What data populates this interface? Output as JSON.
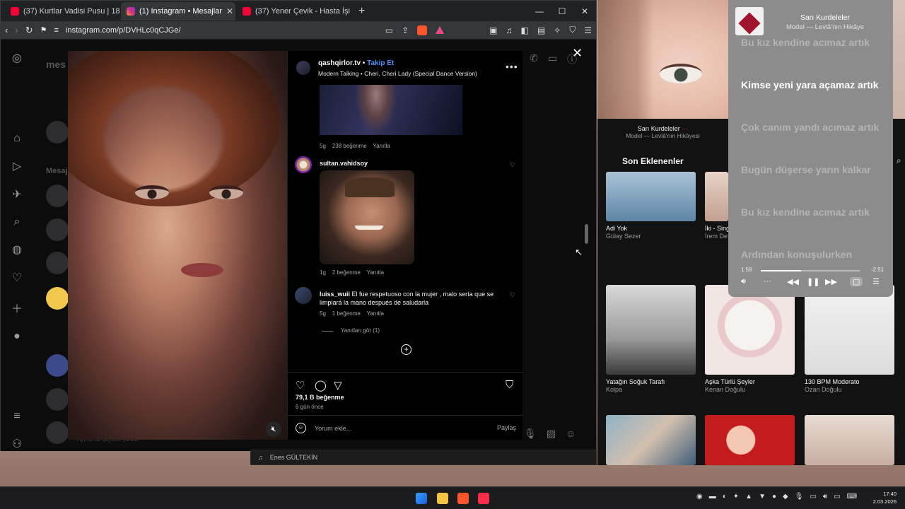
{
  "browser": {
    "tabs": [
      {
        "label": "(37) Kurtlar Vadisi Pusu | 189. Bölüm",
        "icon": "youtube-icon",
        "active": false
      },
      {
        "label": "(1) Instagram • Mesajlar",
        "icon": "instagram-icon",
        "active": true
      },
      {
        "label": "(37) Yener Çevik - Hasta İşi (Ben Büdü",
        "icon": "youtube-icon",
        "active": false
      }
    ],
    "url": "instagram.com/p/DVHLc0qCJGe/"
  },
  "instagram": {
    "dm_title": "mes",
    "messages_label": "Mesaj",
    "composer_text": "Ayırını bir şeylere yamar",
    "post": {
      "username": "qashqirlor.tv",
      "follow_label": "Takip Et",
      "audio": "Modern Talking • Cheri, Cheri Lady (Special Dance Version)",
      "likes": "79,1 B beğenme",
      "time_ago": "6 gün önce",
      "comment_placeholder": "Yorum ekle...",
      "share_label": "Paylaş"
    },
    "comments": [
      {
        "time": "5g",
        "likes": "238 beğenme",
        "reply": "Yanıtla"
      },
      {
        "user": "sultan.vahidsoy",
        "time": "1g",
        "likes": "2 beğenme",
        "reply": "Yanıtla"
      },
      {
        "user": "luiss_wuii",
        "text": "El fue respetuoso con la mujer , malo sería que se limpiará la mano después de saludarla",
        "time": "5g",
        "likes": "1 beğenme",
        "reply": "Yanıtla"
      }
    ],
    "view_replies": "Yanıtları gör (1)"
  },
  "music": {
    "mini_title": "Sarı Kurdeleler",
    "mini_subtitle": "Model — Levlâ'nın Hikâyesi",
    "section_title": "Son Eklenenler",
    "albums_top": [
      {
        "title": "Adi Yok",
        "artist": "Gülay Sezer"
      },
      {
        "title": "İki - Sing",
        "artist": "İrem De"
      }
    ],
    "albums": [
      {
        "title": "Yatağın Soğuk Tarafı",
        "artist": "Kolpa"
      },
      {
        "title": "Aşka Türlü Şeyler",
        "artist": "Kenan Doğulu"
      },
      {
        "title": "130 BPM Moderato",
        "artist": "Ozan Doğulu"
      }
    ],
    "bottom_row_text": "Enes GÜLTEKİN"
  },
  "lyrics": {
    "title": "Sarı Kurdeleler",
    "subtitle": "Model — Levlâ'nın Hikâye",
    "lines": [
      {
        "text": "Bu kız kendine acımaz artık",
        "current": false
      },
      {
        "text": "Kimse yeni yara açamaz artık",
        "current": true
      },
      {
        "text": "Çok canım yandı acımaz artık",
        "current": false
      },
      {
        "text": "Bugün düşerse yarın kalkar",
        "current": false
      },
      {
        "text": "Bu kız kendine acımaz artık",
        "current": false
      },
      {
        "text": "Ardından konuşulurken",
        "current": false
      }
    ],
    "elapsed": "1:59",
    "remaining": "-2:51",
    "progress": 0.41
  },
  "taskbar": {
    "time": "17:40",
    "date": "2.03.2026"
  },
  "colors": {
    "instagram_link": "#4f8ff7",
    "youtube_red": "#ff0033",
    "music_accent": "#fa2d48"
  }
}
